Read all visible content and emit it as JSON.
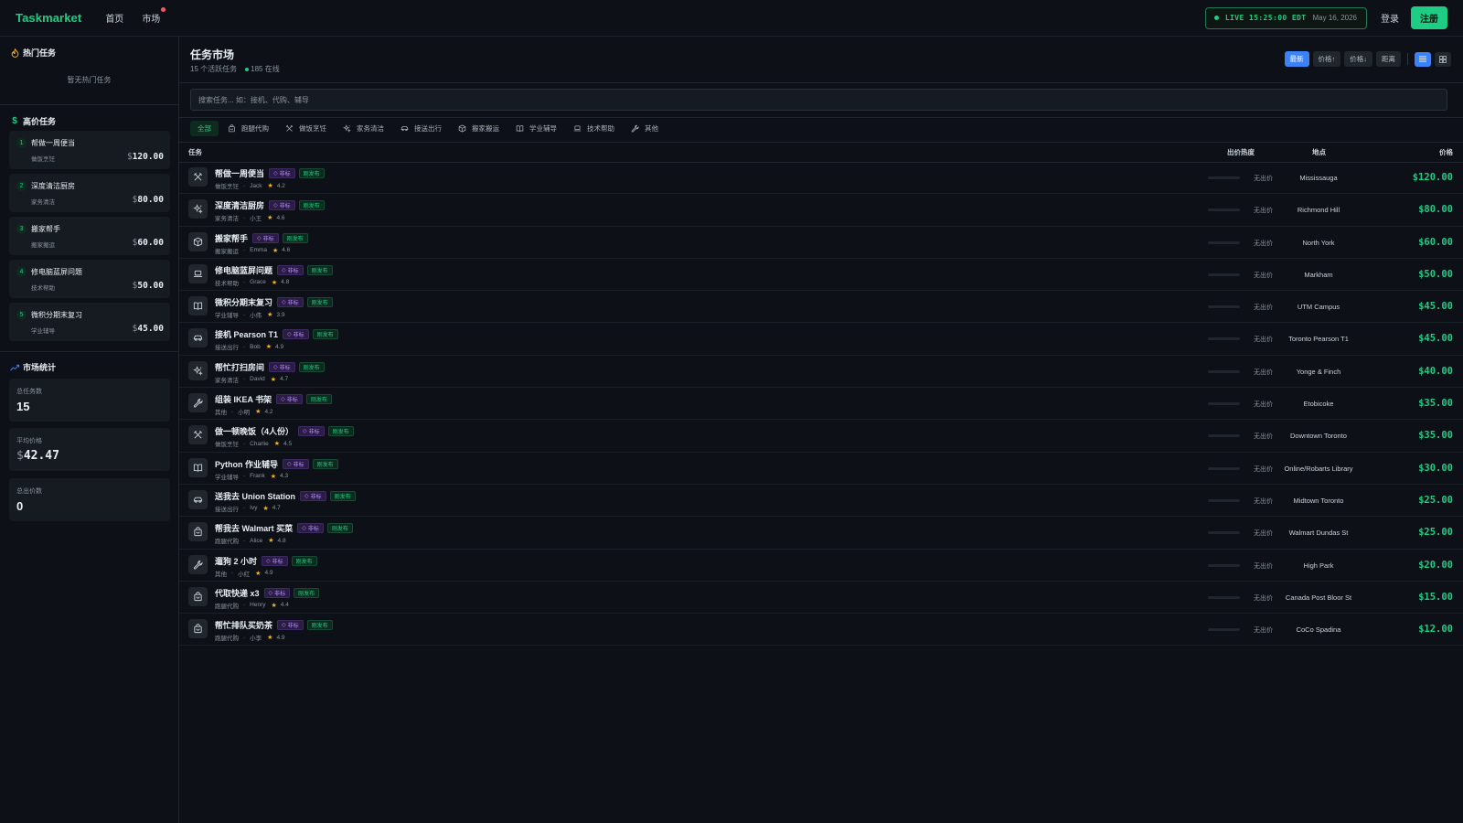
{
  "header": {
    "brand": "Taskmarket",
    "nav": [
      {
        "label": "首页"
      },
      {
        "label": "市场"
      }
    ],
    "live_label": "LIVE 15:25:00 EDT",
    "live_date": "May 16, 2026",
    "login": "登录",
    "signup": "注册"
  },
  "sidebar": {
    "hot_title": "热门任务",
    "hot_empty": "暂无热门任务",
    "high_title": "高价任务",
    "high_items": [
      {
        "rank": "1",
        "title": "帮做一周便当",
        "category": "做饭烹饪",
        "currency": "$",
        "amount": "120.00"
      },
      {
        "rank": "2",
        "title": "深度清洁厨房",
        "category": "家务清洁",
        "currency": "$",
        "amount": "80.00"
      },
      {
        "rank": "3",
        "title": "搬家帮手",
        "category": "搬家搬运",
        "currency": "$",
        "amount": "60.00"
      },
      {
        "rank": "4",
        "title": "修电脑蓝屏问题",
        "category": "技术帮助",
        "currency": "$",
        "amount": "50.00"
      },
      {
        "rank": "5",
        "title": "微积分期末复习",
        "category": "学业辅导",
        "currency": "$",
        "amount": "45.00"
      }
    ],
    "stats_title": "市场统计",
    "stats": {
      "total_label": "总任务数",
      "total_value": "15",
      "avg_label": "平均价格",
      "avg_currency": "$",
      "avg_value": "42.47",
      "bids_label": "总出价数",
      "bids_value": "0"
    }
  },
  "main": {
    "title": "任务市场",
    "active_count": "15 个活跃任务",
    "online": "185 在线",
    "sorts": [
      {
        "label": "最新",
        "active": true
      },
      {
        "label": "价格↑",
        "active": false
      },
      {
        "label": "价格↓",
        "active": false
      },
      {
        "label": "距离",
        "active": false
      }
    ],
    "search_placeholder": "搜索任务... 如：接机、代购、辅导",
    "categories": [
      {
        "label": "全部",
        "icon": "none"
      },
      {
        "label": "跑腿代购",
        "icon": "bag-icon"
      },
      {
        "label": "做饭烹饪",
        "icon": "utensils-icon"
      },
      {
        "label": "家务清洁",
        "icon": "sparkle-icon"
      },
      {
        "label": "接送出行",
        "icon": "car-icon"
      },
      {
        "label": "搬家搬运",
        "icon": "box-icon"
      },
      {
        "label": "学业辅导",
        "icon": "book-icon"
      },
      {
        "label": "技术帮助",
        "icon": "laptop-icon"
      },
      {
        "label": "其他",
        "icon": "wrench-icon"
      }
    ],
    "columns": {
      "task": "任务",
      "heat": "出价热度",
      "location": "地点",
      "price": "价格"
    },
    "bid_tag": "非标",
    "new_tag": "刚发布",
    "no_bid": "无出价",
    "tasks": [
      {
        "title": "帮做一周便当",
        "category": "做饭烹饪",
        "user": "Jack",
        "rating": "4.2",
        "location": "Mississauga",
        "price": "$120.00",
        "icon": "utensils-icon"
      },
      {
        "title": "深度清洁厨房",
        "category": "家务清洁",
        "user": "小王",
        "rating": "4.6",
        "location": "Richmond Hill",
        "price": "$80.00",
        "icon": "sparkle-icon"
      },
      {
        "title": "搬家帮手",
        "category": "搬家搬运",
        "user": "Emma",
        "rating": "4.6",
        "location": "North York",
        "price": "$60.00",
        "icon": "box-icon"
      },
      {
        "title": "修电脑蓝屏问题",
        "category": "技术帮助",
        "user": "Grace",
        "rating": "4.8",
        "location": "Markham",
        "price": "$50.00",
        "icon": "laptop-icon"
      },
      {
        "title": "微积分期末复习",
        "category": "学业辅导",
        "user": "小伟",
        "rating": "3.9",
        "location": "UTM Campus",
        "price": "$45.00",
        "icon": "book-icon"
      },
      {
        "title": "接机 Pearson T1",
        "category": "接送出行",
        "user": "Bob",
        "rating": "4.9",
        "location": "Toronto Pearson T1",
        "price": "$45.00",
        "icon": "car-icon"
      },
      {
        "title": "帮忙打扫房间",
        "category": "家务清洁",
        "user": "David",
        "rating": "4.7",
        "location": "Yonge & Finch",
        "price": "$40.00",
        "icon": "sparkle-icon"
      },
      {
        "title": "组装 IKEA 书架",
        "category": "其他",
        "user": "小明",
        "rating": "4.2",
        "location": "Etobicoke",
        "price": "$35.00",
        "icon": "wrench-icon"
      },
      {
        "title": "做一顿晚饭（4人份）",
        "category": "做饭烹饪",
        "user": "Charlie",
        "rating": "4.5",
        "location": "Downtown Toronto",
        "price": "$35.00",
        "icon": "utensils-icon"
      },
      {
        "title": "Python 作业辅导",
        "category": "学业辅导",
        "user": "Frank",
        "rating": "4.3",
        "location": "Online/Robarts Library",
        "price": "$30.00",
        "icon": "book-icon"
      },
      {
        "title": "送我去 Union Station",
        "category": "接送出行",
        "user": "Ivy",
        "rating": "4.7",
        "location": "Midtown Toronto",
        "price": "$25.00",
        "icon": "car-icon"
      },
      {
        "title": "帮我去 Walmart 买菜",
        "category": "跑腿代购",
        "user": "Alice",
        "rating": "4.8",
        "location": "Walmart Dundas St",
        "price": "$25.00",
        "icon": "bag-icon"
      },
      {
        "title": "遛狗 2 小时",
        "category": "其他",
        "user": "小红",
        "rating": "4.9",
        "location": "High Park",
        "price": "$20.00",
        "icon": "wrench-icon"
      },
      {
        "title": "代取快递 x3",
        "category": "跑腿代购",
        "user": "Henry",
        "rating": "4.4",
        "location": "Canada Post Bloor St",
        "price": "$15.00",
        "icon": "bag-icon"
      },
      {
        "title": "帮忙排队买奶茶",
        "category": "跑腿代购",
        "user": "小李",
        "rating": "4.9",
        "location": "CoCo Spadina",
        "price": "$12.00",
        "icon": "bag-icon"
      }
    ]
  },
  "colors": {
    "accent": "#1fcc83",
    "primary": "#3b82f6",
    "bg": "#0d1117",
    "card": "#161b22",
    "bid_tag": "#b88cff",
    "star": "#f5b31b"
  }
}
